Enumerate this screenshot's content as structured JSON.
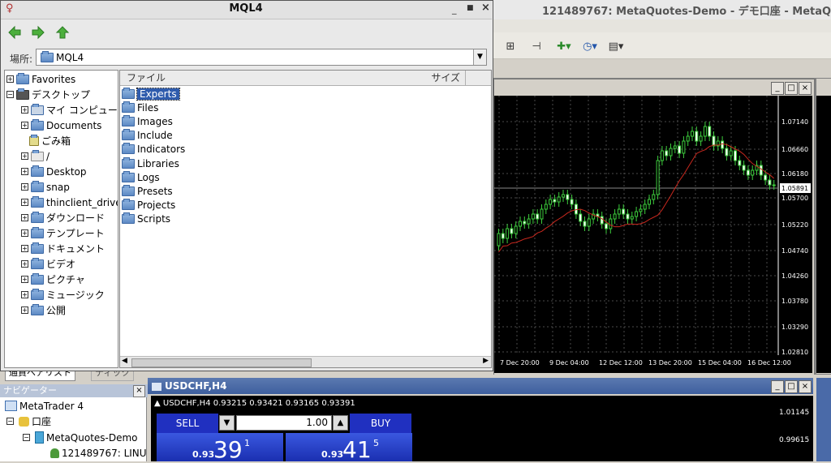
{
  "background_app": {
    "title": "121489767: MetaQuotes-Demo - デモ口座 - MetaQuo"
  },
  "price_chart": {
    "axis_prices": [
      "1.07140",
      "1.06660",
      "1.06180",
      "1.05891",
      "1.05700",
      "1.05220",
      "1.04740",
      "1.04260",
      "1.03780",
      "1.03290",
      "1.02810"
    ],
    "current_price": "1.05891",
    "time_labels": [
      "7 Dec 20:00",
      "9 Dec 04:00",
      "12 Dec 12:00",
      "13 Dec 20:00",
      "15 Dec 04:00",
      "16 Dec 12:00"
    ]
  },
  "usdchf": {
    "title": "USDCHF,H4",
    "info": "USDCHF,H4  0.93215 0.93421 0.93165 0.93391",
    "sell": "SELL",
    "buy": "BUY",
    "lots": "1.00",
    "sell_price_prefix": "0.93",
    "sell_price_big": "39",
    "sell_price_sup": "1",
    "buy_price_prefix": "0.93",
    "buy_price_big": "41",
    "buy_price_sup": "5",
    "axis_prices": [
      "1.01145",
      "0.99615"
    ]
  },
  "navigator": {
    "tab1": "通貨ペアリスト",
    "tab2": "ティック",
    "header": "ナビゲーター",
    "items": [
      "MetaTrader 4",
      "口座",
      "MetaQuotes-Demo",
      "121489767: LINU"
    ]
  },
  "dialog": {
    "title": "MQL4",
    "location_label": "場所:",
    "location_value": "MQL4",
    "tree": [
      {
        "label": "Favorites",
        "expander": "+",
        "icon": "folder"
      },
      {
        "label": "デスクトップ",
        "expander": "-",
        "icon": "desktop"
      },
      {
        "label": "マイ コンピュータ",
        "expander": "+",
        "icon": "computer"
      },
      {
        "label": "Documents",
        "expander": "+",
        "icon": "folder"
      },
      {
        "label": "ごみ箱",
        "expander": "",
        "icon": "trash"
      },
      {
        "label": "/",
        "expander": "+",
        "icon": "drive"
      },
      {
        "label": "Desktop",
        "expander": "+",
        "icon": "folder"
      },
      {
        "label": "snap",
        "expander": "+",
        "icon": "folder"
      },
      {
        "label": "thinclient_drives",
        "expander": "+",
        "icon": "folder"
      },
      {
        "label": "ダウンロード",
        "expander": "+",
        "icon": "folder"
      },
      {
        "label": "テンプレート",
        "expander": "+",
        "icon": "folder"
      },
      {
        "label": "ドキュメント",
        "expander": "+",
        "icon": "folder"
      },
      {
        "label": "ビデオ",
        "expander": "+",
        "icon": "folder"
      },
      {
        "label": "ピクチャ",
        "expander": "+",
        "icon": "folder"
      },
      {
        "label": "ミュージック",
        "expander": "+",
        "icon": "folder"
      },
      {
        "label": "公開",
        "expander": "+",
        "icon": "folder"
      }
    ],
    "columns": {
      "file": "ファイル",
      "size": "サイズ"
    },
    "files": [
      "Experts",
      "Files",
      "Images",
      "Include",
      "Indicators",
      "Libraries",
      "Logs",
      "Presets",
      "Projects",
      "Scripts"
    ],
    "selected_file": "Experts"
  }
}
